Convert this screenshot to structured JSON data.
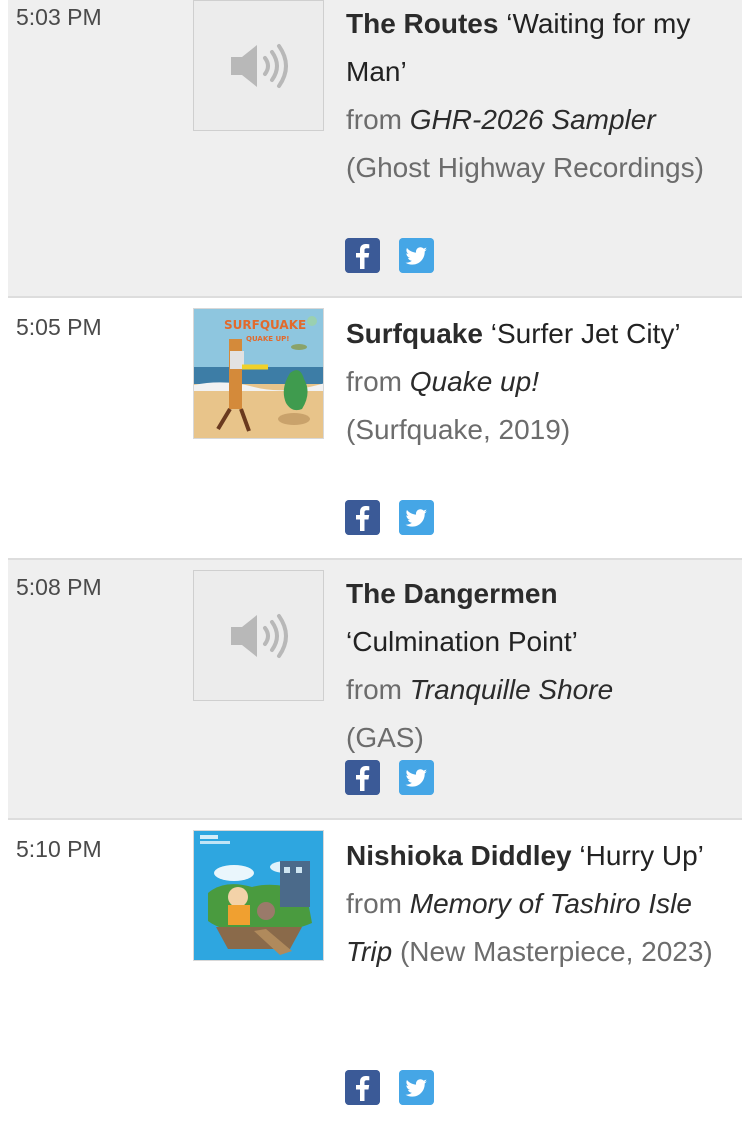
{
  "entries": [
    {
      "time": "5:03 PM",
      "artist": "The Routes",
      "title": "‘Waiting for my Man’",
      "from": "from",
      "album": "GHR-2026 Sampler",
      "label": "(Ghost Highway Recordings)",
      "art": "speaker-icon"
    },
    {
      "time": "5:05 PM",
      "artist": "Surfquake",
      "title": "‘Surfer Jet City’",
      "from": "from",
      "album": "Quake up!",
      "label": "(Surfquake, 2019)",
      "art": "album-cover",
      "cover_text": [
        "SURFQUAKE",
        "QUAKE UP!"
      ]
    },
    {
      "time": "5:08 PM",
      "artist": "The Dangermen",
      "title": "‘Culmination Point’",
      "from": "from",
      "album": "Tranquille Shore",
      "label": "(GAS)",
      "art": "speaker-icon"
    },
    {
      "time": "5:10 PM",
      "artist": "Nishioka Diddley",
      "title": "‘Hurry Up’",
      "from": "from",
      "album": "Memory of Tashiro Isle Trip",
      "label": "(New Masterpiece, 2023)",
      "art": "album-cover"
    }
  ],
  "social": {
    "facebook": "facebook-icon",
    "twitter": "twitter-icon"
  },
  "colors": {
    "facebook": "#3b5a97",
    "twitter": "#45a6e6",
    "row_alt": "#efefef"
  }
}
